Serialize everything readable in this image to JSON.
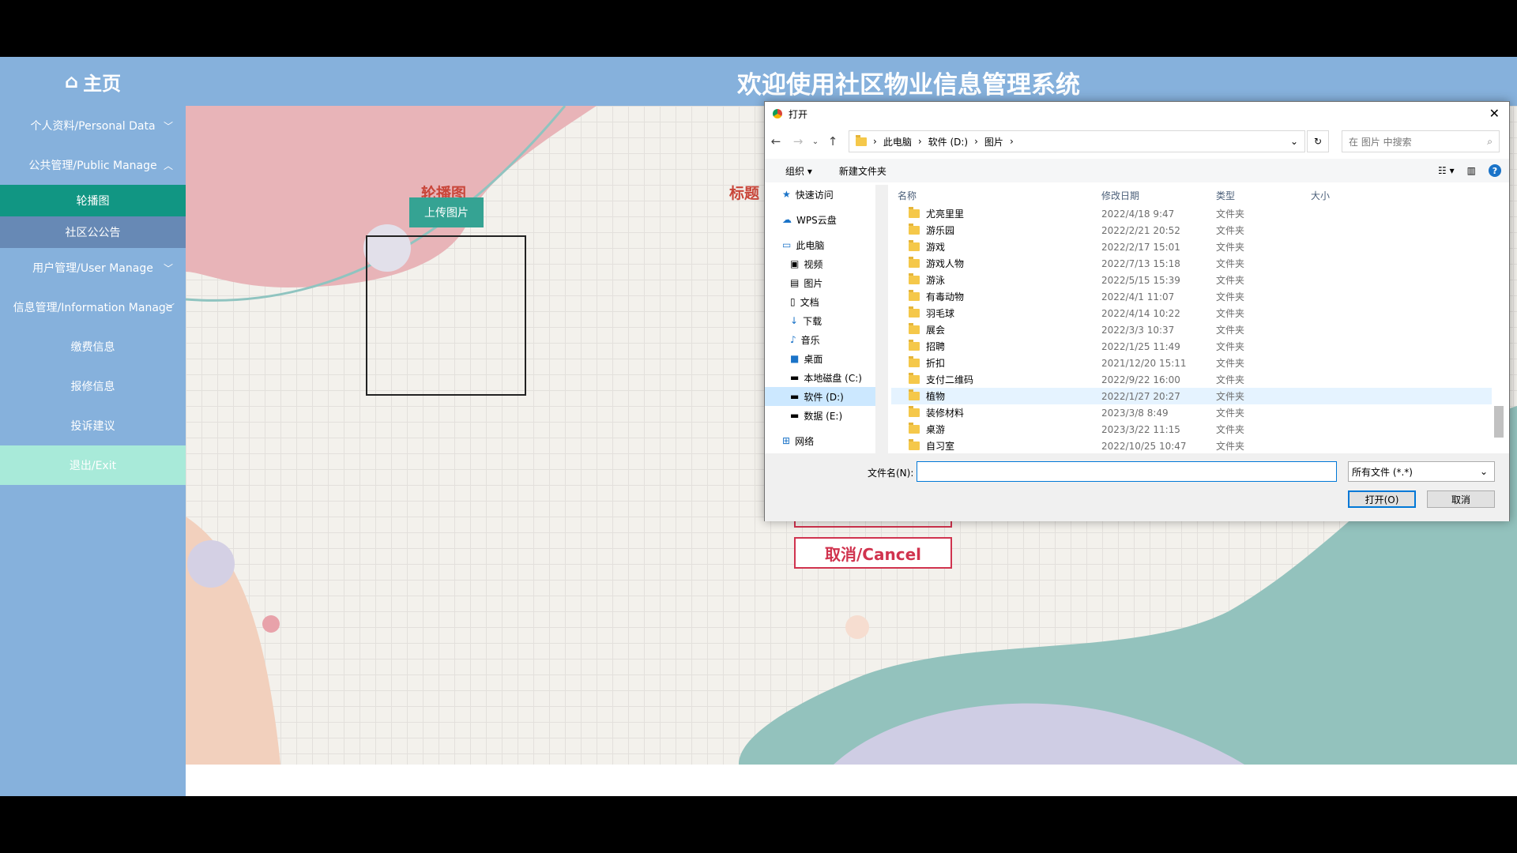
{
  "header": {
    "home_icon": "⌂",
    "home_label": "主页",
    "system_title": "欢迎使用社区物业信息管理系统"
  },
  "sidebar": {
    "items": [
      {
        "label": "个人资料/Personal Data",
        "chevron": "﹀"
      },
      {
        "label": "公共管理/Public Manage",
        "chevron": "︿"
      },
      {
        "label": "轮播图"
      },
      {
        "label": "社区公公告"
      },
      {
        "label": "用户管理/User Manage",
        "chevron": "﹀"
      },
      {
        "label": "信息管理/Information Manage",
        "chevron": "﹀"
      },
      {
        "label": "缴费信息"
      },
      {
        "label": "报修信息"
      },
      {
        "label": "投诉建议"
      },
      {
        "label": "退出/Exit"
      }
    ]
  },
  "form": {
    "carousel_label": "轮播图",
    "title_label": "标题",
    "upload_label": "上传图片",
    "cancel_label": "取消/Cancel"
  },
  "dialog": {
    "title": "打开",
    "close": "✕",
    "breadcrumb": [
      "此电脑",
      "软件 (D:)",
      "图片"
    ],
    "search_placeholder": "在 图片 中搜索",
    "organize": "组织 ▾",
    "new_folder": "新建文件夹",
    "nav": [
      {
        "label": "快速访问",
        "icon": "★"
      },
      {
        "label": "WPS云盘",
        "icon": "☁"
      },
      {
        "label": "此电脑",
        "icon": "▭"
      },
      {
        "label": "视频",
        "icon": "▣"
      },
      {
        "label": "图片",
        "icon": "▤"
      },
      {
        "label": "文档",
        "icon": "▯"
      },
      {
        "label": "下载",
        "icon": "↓"
      },
      {
        "label": "音乐",
        "icon": "♪"
      },
      {
        "label": "桌面",
        "icon": "■"
      },
      {
        "label": "本地磁盘 (C:)",
        "icon": "▬"
      },
      {
        "label": "软件 (D:)",
        "icon": "▬"
      },
      {
        "label": "数据 (E:)",
        "icon": "▬"
      },
      {
        "label": "网络",
        "icon": "⊞"
      }
    ],
    "columns": {
      "name": "名称",
      "date": "修改日期",
      "type": "类型",
      "size": "大小"
    },
    "files": [
      {
        "name": "尤亮里里",
        "date": "2022/4/18 9:47",
        "type": "文件夹"
      },
      {
        "name": "游乐园",
        "date": "2022/2/21 20:52",
        "type": "文件夹"
      },
      {
        "name": "游戏",
        "date": "2022/2/17 15:01",
        "type": "文件夹"
      },
      {
        "name": "游戏人物",
        "date": "2022/7/13 15:18",
        "type": "文件夹"
      },
      {
        "name": "游泳",
        "date": "2022/5/15 15:39",
        "type": "文件夹"
      },
      {
        "name": "有毒动物",
        "date": "2022/4/1 11:07",
        "type": "文件夹"
      },
      {
        "name": "羽毛球",
        "date": "2022/4/14 10:22",
        "type": "文件夹"
      },
      {
        "name": "展会",
        "date": "2022/3/3 10:37",
        "type": "文件夹"
      },
      {
        "name": "招聘",
        "date": "2022/1/25 11:49",
        "type": "文件夹"
      },
      {
        "name": "折扣",
        "date": "2021/12/20 15:11",
        "type": "文件夹"
      },
      {
        "name": "支付二维码",
        "date": "2022/9/22 16:00",
        "type": "文件夹"
      },
      {
        "name": "植物",
        "date": "2022/1/27 20:27",
        "type": "文件夹"
      },
      {
        "name": "装修材料",
        "date": "2023/3/8 8:49",
        "type": "文件夹"
      },
      {
        "name": "桌游",
        "date": "2023/3/22 11:15",
        "type": "文件夹"
      },
      {
        "name": "自习室",
        "date": "2022/10/25 10:47",
        "type": "文件夹"
      }
    ],
    "filename_label": "文件名(N):",
    "filename_value": "",
    "filter": "所有文件 (*.*)",
    "open_btn": "打开(O)",
    "cancel_btn": "取消"
  }
}
